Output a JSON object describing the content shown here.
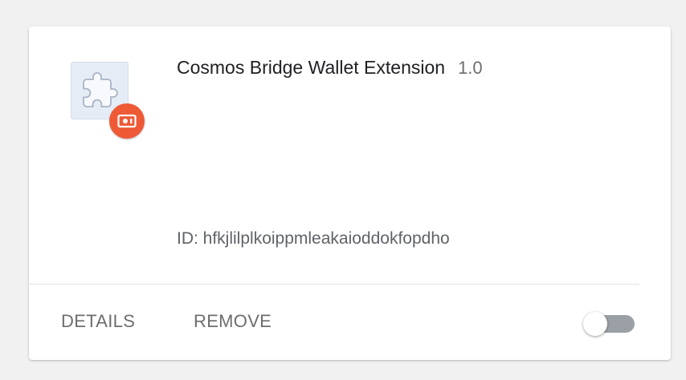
{
  "extension": {
    "name": "Cosmos Bridge Wallet Extension",
    "version": "1.0",
    "id_text": "ID: hfkjlilplkoippmleakaioddokfopdho",
    "icon": "puzzle-piece-icon",
    "source_badge_icon": "web-store-badge-icon",
    "enabled": false
  },
  "actions": {
    "details_label": "DETAILS",
    "remove_label": "REMOVE"
  },
  "colors": {
    "badge": "#ee5a36",
    "icon_background": "#e6ecf6",
    "toggle_track": "#9aa0a6"
  }
}
